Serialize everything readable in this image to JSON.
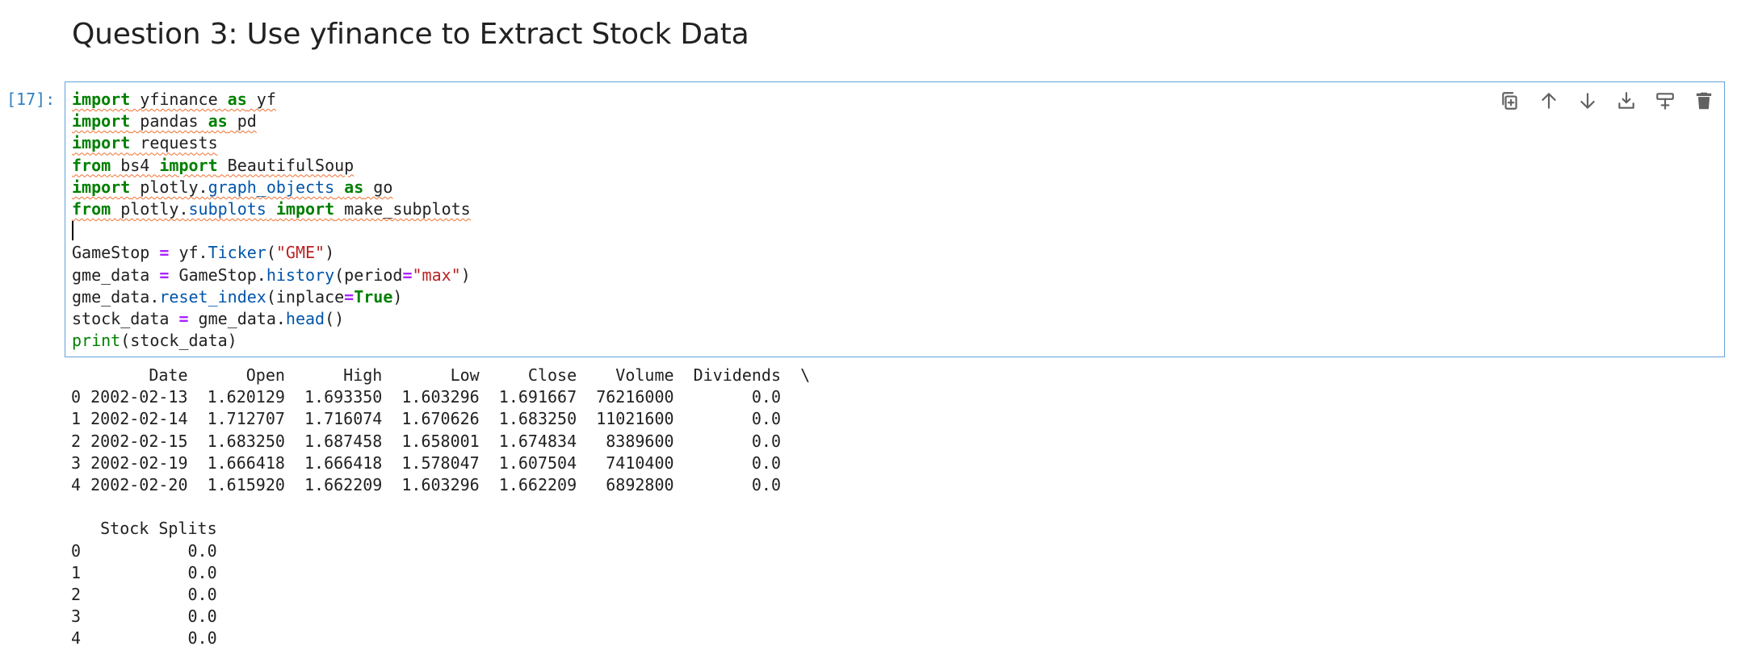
{
  "heading": "Question 3: Use yfinance to Extract Stock Data",
  "cell": {
    "prompt": "[17]:",
    "toolbar": {
      "duplicate_icon": "duplicate-icon",
      "move_up_icon": "arrow-up-icon",
      "move_down_icon": "arrow-down-icon",
      "insert_below_icon": "insert-below-icon",
      "insert_above_icon": "insert-above-icon",
      "delete_icon": "trash-icon"
    },
    "code": {
      "l1": {
        "k1": "import",
        "m": " yfinance ",
        "k2": "as",
        "a": " yf"
      },
      "l2": {
        "k1": "import",
        "m": " pandas ",
        "k2": "as",
        "a": " pd"
      },
      "l3": {
        "k1": "import",
        "m": " requests"
      },
      "l4": {
        "k1": "from",
        "m": " bs4 ",
        "k2": "import",
        "a": " BeautifulSoup"
      },
      "l5": {
        "k1": "import",
        "m1": " plotly.",
        "attr": "graph_objects",
        "m2": " ",
        "k2": "as",
        "a": " go"
      },
      "l6": {
        "k1": "from",
        "m1": " plotly.",
        "attr": "subplots",
        "m2": " ",
        "k2": "import",
        "a": " make_subplots"
      },
      "l8": {
        "v": "GameStop ",
        "op": "=",
        "m": " yf.",
        "attr": "Ticker",
        "p1": "(",
        "str": "\"GME\"",
        "p2": ")"
      },
      "l9": {
        "v": "gme_data ",
        "op": "=",
        "m": " GameStop.",
        "attr": "history",
        "p1": "(period",
        "op2": "=",
        "str": "\"max\"",
        "p2": ")"
      },
      "l10": {
        "v": "gme_data.",
        "attr": "reset_index",
        "p1": "(inplace",
        "op": "=",
        "kw": "True",
        "p2": ")"
      },
      "l11": {
        "v": "stock_data ",
        "op": "=",
        "m": " gme_data.",
        "attr": "head",
        "p": "()"
      },
      "l12": {
        "bi": "print",
        "p": "(stock_data)"
      }
    }
  },
  "output": {
    "table1_header": "        Date      Open      High       Low     Close    Volume  Dividends  \\",
    "table1_rows": [
      "0 2002-02-13  1.620129  1.693350  1.603296  1.691667  76216000        0.0",
      "1 2002-02-14  1.712707  1.716074  1.670626  1.683250  11021600        0.0",
      "2 2002-02-15  1.683250  1.687458  1.658001  1.674834   8389600        0.0",
      "3 2002-02-19  1.666418  1.666418  1.578047  1.607504   7410400        0.0",
      "4 2002-02-20  1.615920  1.662209  1.603296  1.662209   6892800        0.0"
    ],
    "table2_header": "   Stock Splits",
    "table2_rows": [
      "0           0.0",
      "1           0.0",
      "2           0.0",
      "3           0.0",
      "4           0.0"
    ]
  }
}
